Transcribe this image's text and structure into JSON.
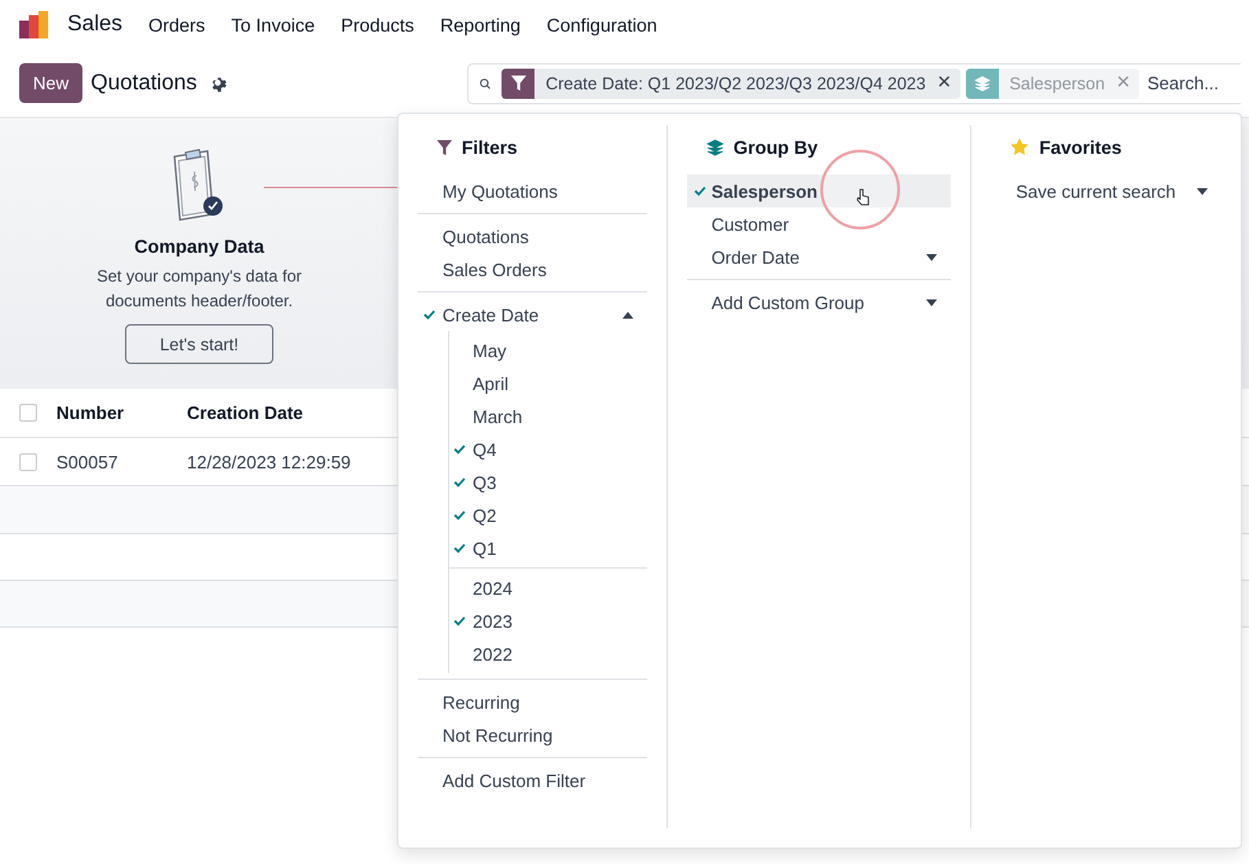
{
  "nav": {
    "app": "Sales",
    "menu": [
      "Orders",
      "To Invoice",
      "Products",
      "Reporting",
      "Configuration"
    ]
  },
  "control": {
    "new_button": "New",
    "title": "Quotations"
  },
  "search": {
    "placeholder": "Search...",
    "facets": [
      {
        "kind": "filter",
        "text": "Create Date: Q1 2023/Q2 2023/Q3 2023/Q4 2023",
        "close": "✕"
      },
      {
        "kind": "groupby",
        "text": "Salesperson",
        "close": "✕"
      }
    ]
  },
  "onboarding": {
    "title": "Company Data",
    "text": "Set your company's data for documents header/footer.",
    "button": "Let's start!"
  },
  "table": {
    "all_checked": false,
    "columns": [
      "Number",
      "Creation Date"
    ],
    "rows": [
      {
        "number": "S00057",
        "creation_date": "12/28/2023 12:29:59",
        "checked": false
      }
    ]
  },
  "dropdown": {
    "filters": {
      "title": "Filters",
      "sections": [
        [
          {
            "label": "My Quotations",
            "checked": false
          }
        ],
        [
          {
            "label": "Quotations",
            "checked": false
          },
          {
            "label": "Sales Orders",
            "checked": false
          }
        ],
        [
          {
            "label": "Create Date",
            "checked": true,
            "expanded": true,
            "children": [
              [
                {
                  "label": "May",
                  "checked": false
                },
                {
                  "label": "April",
                  "checked": false
                },
                {
                  "label": "March",
                  "checked": false
                },
                {
                  "label": "Q4",
                  "checked": true
                },
                {
                  "label": "Q3",
                  "checked": true
                },
                {
                  "label": "Q2",
                  "checked": true
                },
                {
                  "label": "Q1",
                  "checked": true
                }
              ],
              [
                {
                  "label": "2024",
                  "checked": false
                },
                {
                  "label": "2023",
                  "checked": true
                },
                {
                  "label": "2022",
                  "checked": false
                }
              ]
            ]
          }
        ],
        [
          {
            "label": "Recurring",
            "checked": false
          },
          {
            "label": "Not Recurring",
            "checked": false
          }
        ],
        [
          {
            "label": "Add Custom Filter",
            "checked": false
          }
        ]
      ]
    },
    "group_by": {
      "title": "Group By",
      "sections": [
        [
          {
            "label": "Salesperson",
            "kind": "option",
            "checked": true,
            "hovered": true
          },
          {
            "label": "Customer",
            "kind": "option",
            "checked": false,
            "hovered": false
          },
          {
            "label": "Order Date",
            "kind": "select",
            "checked": false,
            "hovered": false
          }
        ],
        [
          {
            "label": "Add Custom Group",
            "kind": "select",
            "checked": false,
            "hovered": false
          }
        ]
      ]
    },
    "favorites": {
      "title": "Favorites",
      "items": [
        {
          "label": "Save current search",
          "kind": "select"
        }
      ]
    }
  }
}
